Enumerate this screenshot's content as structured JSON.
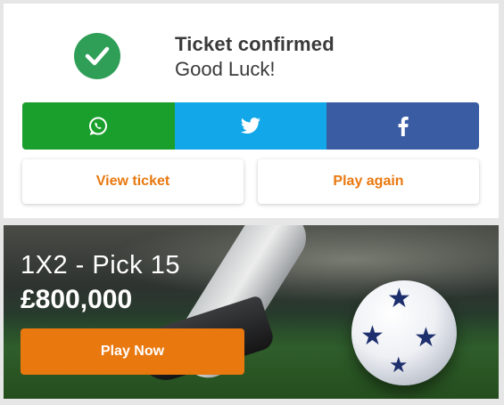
{
  "confirmation": {
    "title": "Ticket confirmed",
    "subtitle": "Good Luck!",
    "icon": "check-circle-icon",
    "icon_color": "#2f9e57"
  },
  "share": {
    "buttons": [
      {
        "network": "WhatsApp",
        "icon": "whatsapp-icon",
        "color": "#1a9e2c"
      },
      {
        "network": "Twitter",
        "icon": "twitter-icon",
        "color": "#12a7e9"
      },
      {
        "network": "Facebook",
        "icon": "facebook-icon",
        "color": "#3a5ca3"
      }
    ]
  },
  "actions": {
    "view_ticket_label": "View ticket",
    "play_again_label": "Play again",
    "accent_color": "#e9780f"
  },
  "banner": {
    "game": "1X2 - Pick 15",
    "prize": "£800,000",
    "play_label": "Play Now"
  }
}
